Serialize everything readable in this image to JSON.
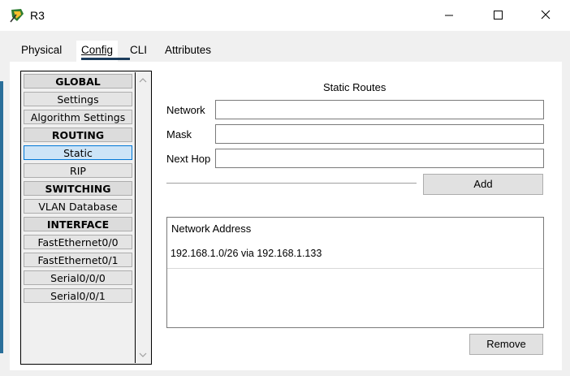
{
  "window": {
    "title": "R3",
    "minimize_icon": "minimize-icon",
    "maximize_icon": "maximize-icon",
    "close_icon": "close-icon"
  },
  "tabs": [
    {
      "label": "Physical",
      "active": false
    },
    {
      "label": "Config",
      "active": true
    },
    {
      "label": "CLI",
      "active": false
    },
    {
      "label": "Attributes",
      "active": false
    }
  ],
  "nav": {
    "items": [
      {
        "label": "GLOBAL",
        "header": true
      },
      {
        "label": "Settings"
      },
      {
        "label": "Algorithm Settings"
      },
      {
        "label": "ROUTING",
        "header": true
      },
      {
        "label": "Static",
        "selected": true
      },
      {
        "label": "RIP"
      },
      {
        "label": "SWITCHING",
        "header": true
      },
      {
        "label": "VLAN Database"
      },
      {
        "label": "INTERFACE",
        "header": true
      },
      {
        "label": "FastEthernet0/0"
      },
      {
        "label": "FastEthernet0/1"
      },
      {
        "label": "Serial0/0/0"
      },
      {
        "label": "Serial0/0/1"
      }
    ]
  },
  "static_routes": {
    "title": "Static Routes",
    "network_label": "Network",
    "network_value": "",
    "mask_label": "Mask",
    "mask_value": "",
    "next_hop_label": "Next Hop",
    "next_hop_value": "",
    "add_label": "Add",
    "list_header": "Network Address",
    "routes": [
      "192.168.1.0/26 via 192.168.1.133"
    ],
    "remove_label": "Remove"
  },
  "colors": {
    "selected_bg": "#cce4f7",
    "active_tab_bar": "#1c3c5c"
  }
}
